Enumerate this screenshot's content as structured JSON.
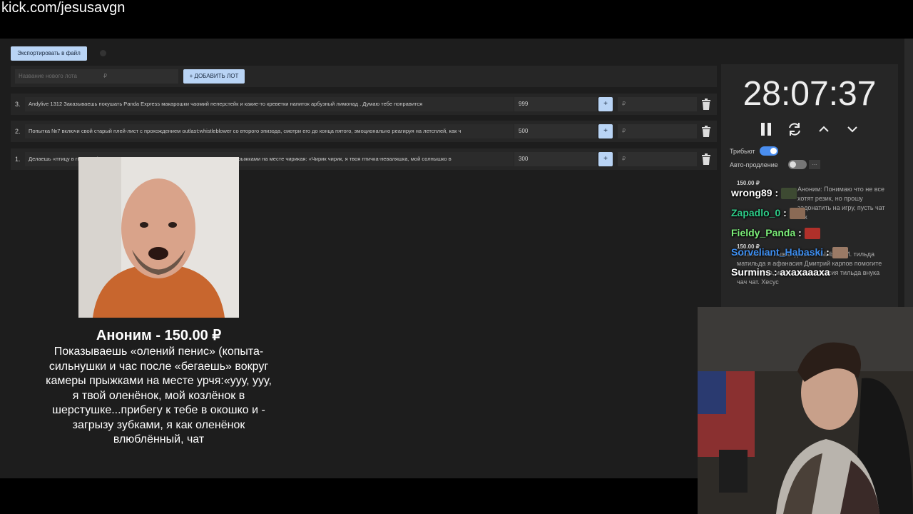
{
  "browser": {
    "url": "kick.com/jesusavgn"
  },
  "toolbar": {
    "export_label": "Экспортировать в файл"
  },
  "add_lot": {
    "name_placeholder": "Название нового лота",
    "price_placeholder": "₽",
    "add_button_label": "+ ДОБАВИТЬ ЛОТ"
  },
  "lots": [
    {
      "number": "3.",
      "text": "Andylive 1312 Заказываешь покушать Panda Express макарошки чаомий пеперстейк и какие-то креветки напиток арбузный лимонад . Думаю тебе понравится",
      "amount": "999",
      "plus": "+",
      "rub_placeholder": "₽"
    },
    {
      "number": "2.",
      "text": "Попытка №7 включи свой старый плей-лист с прохождением outlast:whistleblower со второго эпизода, смотри его до конца пятого, эмоционально реагируя на летсплей, как ч",
      "amount": "500",
      "plus": "+",
      "rub_placeholder": "₽"
    },
    {
      "number": "1.",
      "text": "Делаешь «птицу в гнезде» (руки в кулачки и час после «порхаешь» вокруг камеры прыжками на месте чирикая: «Чирик чирик, я твоя птичка-неваляшка, мой солнышко в",
      "amount": "300",
      "plus": "+",
      "rub_placeholder": "₽"
    }
  ],
  "timer": {
    "value": "28:07:37"
  },
  "settings": {
    "tribute_label": "Трибьют",
    "tribute_on": true,
    "auto_label": "Авто-продление",
    "auto_on": false,
    "auto_more": "..."
  },
  "donations": [
    {
      "amount": "150.00 ₽",
      "text": "Аноним: Понимаю что не все хотят резик, но прошу задонатить на игру, пусть чат чик"
    },
    {
      "amount": "150.00 ₽",
      "text": "Аноним: На лыжах дашь КРЫЛЫШКИ. тильда матильда я афанасия Дмитрий карпов помогите найти внука, имя внука Афанасия тильда внука чач чат. Хесус"
    }
  ],
  "chat": [
    {
      "user": "wrong89",
      "message": "",
      "color": "#ffffff",
      "emote": "camo-emote"
    },
    {
      "user": "Zapadlo_0",
      "message": "",
      "color": "#2ecf8a",
      "emote": "face-emote"
    },
    {
      "user": "Fieldy_Panda",
      "message": "",
      "color": "#7df07a",
      "emote": "red-face-emote"
    },
    {
      "user": "Sorveliant_Habaski",
      "message": "",
      "color": "#3d8ef0",
      "emote": "face-emote"
    },
    {
      "user": "Surmins",
      "message": "ахахаааха",
      "color": "#ffffff",
      "emote": ""
    }
  ],
  "alert": {
    "title": "Аноним - 150.00 ₽",
    "message": "Показываешь «олений пенис» (копыта-сильнушки и час после «бегаешь» вокруг камеры прыжками на месте урчя:«ууу, ууу, я твой оленёнок, мой козлёнок в шерстушке...прибегу к тебе в окошко и - загрызу зубками, я как оленёнок влюблённый, чат"
  },
  "colors": {
    "accent": "#b9d4f5",
    "toggle_on": "#4a8ef0",
    "panel": "#262626",
    "background": "#1d1d1d"
  }
}
